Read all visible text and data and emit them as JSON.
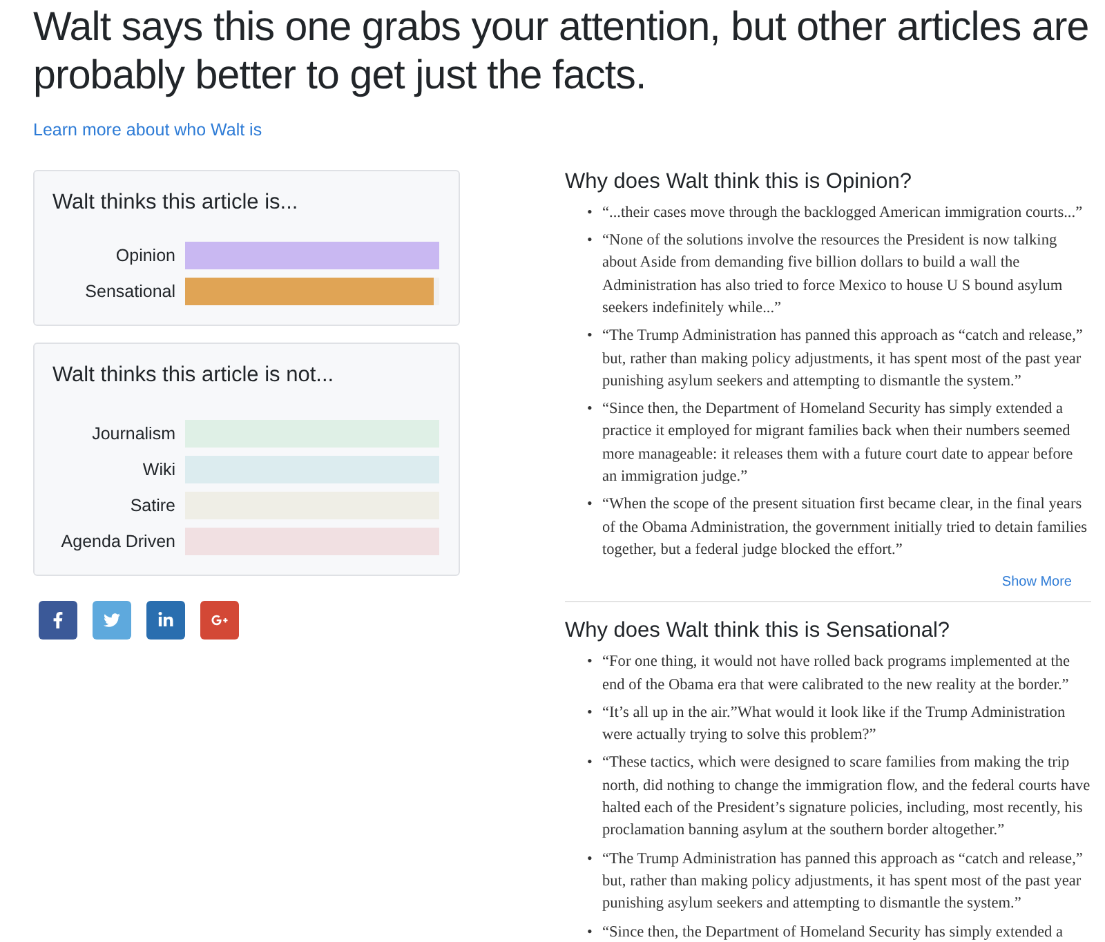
{
  "headline": "Walt says this one grabs your attention, but other articles are probably better to get just the facts.",
  "learn_more_link": "Learn more about who Walt is",
  "panels": [
    {
      "title": "Walt thinks this article is...",
      "bars": [
        {
          "label": "Opinion",
          "level": 1,
          "color": "#c9b8f2"
        },
        {
          "label": "Sensational",
          "level": 0.98,
          "color": "#e0a455"
        }
      ]
    },
    {
      "title": "Walt thinks this article is not...",
      "bars": [
        {
          "label": "Journalism",
          "level": 1,
          "color": "#dff0e6"
        },
        {
          "label": "Wiki",
          "level": 1,
          "color": "#dcecef"
        },
        {
          "label": "Satire",
          "level": 1,
          "color": "#efeee6"
        },
        {
          "label": "Agenda Driven",
          "level": 1,
          "color": "#f1e0e2"
        }
      ]
    }
  ],
  "share_buttons": [
    {
      "kind": "facebook"
    },
    {
      "kind": "twitter"
    },
    {
      "kind": "linkedin"
    },
    {
      "kind": "googleplus"
    }
  ],
  "reasons": [
    {
      "title": "Why does Walt think this is Opinion?",
      "bullet": "•",
      "quotes": [
        "“...their cases move through the backlogged American immigration courts...”",
        "“None of the solutions involve the resources the President is now talking about Aside from demanding five billion dollars to build a wall the Administration has also tried to force Mexico to house U S bound asylum seekers indefinitely while...”",
        "“The Trump Administration has panned this approach as “catch and release,” but, rather than making policy adjustments, it has spent most of the past year punishing asylum seekers and attempting to dismantle the system.”",
        "“Since then, the Department of Homeland Security has simply extended a practice it employed for migrant families back when their numbers seemed more manageable: it releases them with a future court date to appear before an immigration judge.”",
        "“When the scope of the present situation first became clear, in the final years of the Obama Administration, the government initially tried to detain families together, but a federal judge blocked the effort.”"
      ],
      "show_more": "Show More"
    },
    {
      "title": "Why does Walt think this is Sensational?",
      "bullet": "•",
      "quotes": [
        "“For one thing, it would not have rolled back programs implemented at the end of the Obama era that were calibrated to the new reality at the border.”",
        "“It’s all up in the air.”What would it look like if the Trump Administration were actually trying to solve this problem?”",
        "“These tactics, which were designed to scare families from making the trip north, did nothing to change the immigration flow, and the federal courts have halted each of the President’s signature policies, including, most recently, his proclamation banning asylum at the southern border altogether.”",
        "“The Trump Administration has panned this approach as “catch and release,” but, rather than making policy adjustments, it has spent most of the past year punishing asylum seekers and attempting to dismantle the system.”",
        "“Since then, the Department of Homeland Security has simply extended a"
      ]
    }
  ]
}
